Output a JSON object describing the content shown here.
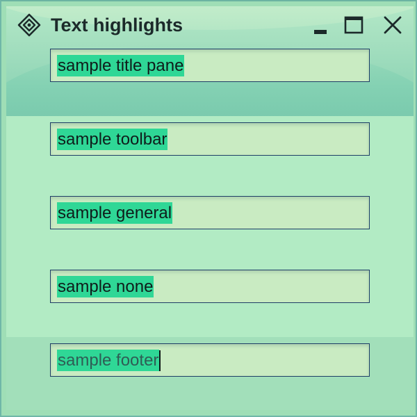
{
  "window": {
    "title": "Text highlights",
    "icons": {
      "app": "diamond-crosshair-icon",
      "minimize": "minimize-icon",
      "maximize": "maximize-icon",
      "close": "close-icon"
    }
  },
  "fields": {
    "title_pane": "sample title pane",
    "toolbar": "sample toolbar",
    "general": "sample general",
    "none": "sample none",
    "footer": "sample footer"
  },
  "colors": {
    "highlight": "#2fd796",
    "field_background": "#c9ebc2",
    "field_border": "#1e3d66",
    "content_background": "#b2ebc4",
    "footer_background": "#a2dfba",
    "title_text": "#1c2a2a"
  }
}
